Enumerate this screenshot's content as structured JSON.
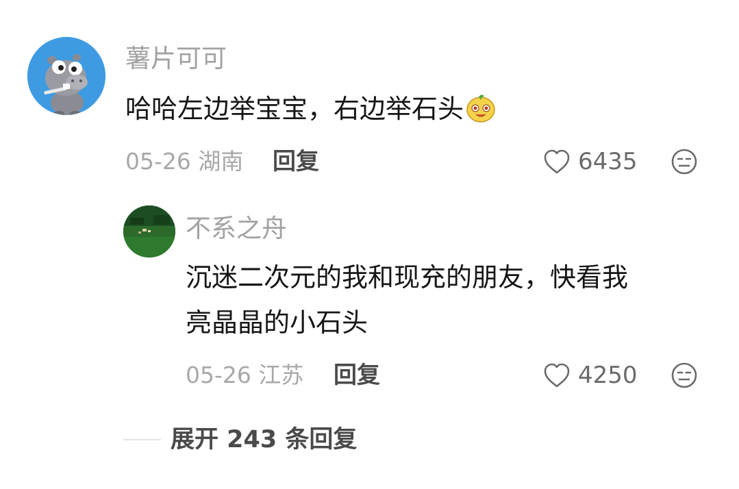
{
  "comments": [
    {
      "username": "薯片可可",
      "text": "哈哈左边举宝宝，右边举石头",
      "emoji": "smiling-potato-emoji",
      "date": "05-26",
      "location": "湖南",
      "reply_label": "回复",
      "likes": "6435",
      "avatar_icon": "hippo-avatar",
      "replies": [
        {
          "username": "不系之舟",
          "text_line1": "沉迷二次元的我和现充的朋友，快看我",
          "text_line2": "亮晶晶的小石头",
          "date": "05-26",
          "location": "江苏",
          "reply_label": "回复",
          "likes": "4250",
          "avatar_icon": "landscape-avatar"
        }
      ]
    }
  ],
  "expand": {
    "label": "展开 243 条回复"
  },
  "icons": {
    "like": "heart-outline-icon",
    "dislike": "meh-face-icon"
  },
  "colors": {
    "username": "#a2a2a2",
    "meta": "#a8a8a8",
    "reply": "#4a4a4a",
    "body_text": "#161616"
  }
}
